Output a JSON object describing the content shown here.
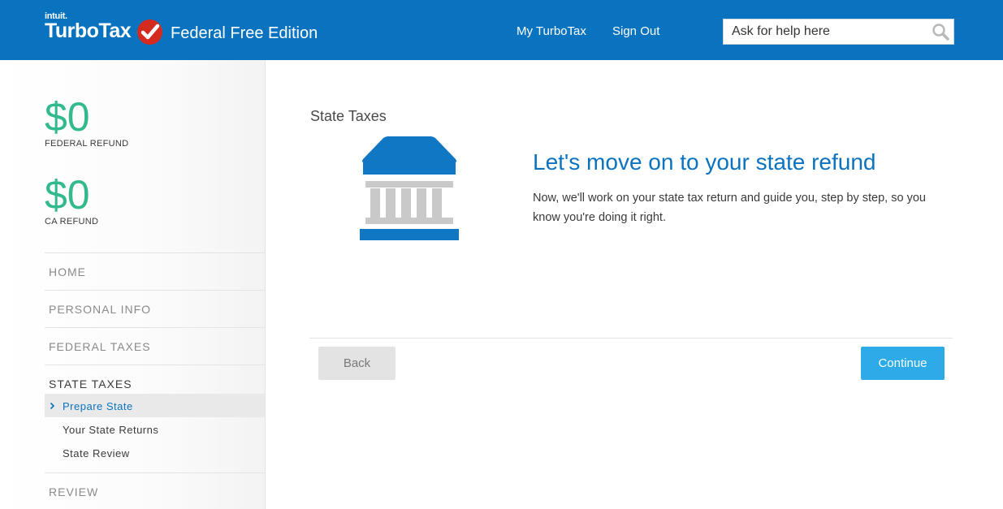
{
  "header": {
    "brand_small": "intuit.",
    "brand": "TurboTax",
    "edition": "Federal Free Edition",
    "nav": [
      {
        "label": "My TurboTax"
      },
      {
        "label": "Sign Out"
      }
    ],
    "search": {
      "placeholder": "Ask for help here",
      "icon": "search-icon"
    },
    "colors": {
      "header_bg": "#0a73bf",
      "check_red": "#d52b1e"
    }
  },
  "sidebar": {
    "refunds": [
      {
        "amount": "$0",
        "label": "FEDERAL REFUND"
      },
      {
        "amount": "$0",
        "label": "CA REFUND"
      }
    ],
    "sections": [
      {
        "label": "HOME"
      },
      {
        "label": "PERSONAL INFO"
      },
      {
        "label": "FEDERAL TAXES"
      },
      {
        "label": "STATE TAXES",
        "active": true
      },
      {
        "label": "REVIEW"
      }
    ],
    "sub_items": [
      {
        "label": "Prepare State",
        "active": true
      },
      {
        "label": "Your State Returns"
      },
      {
        "label": "State Review"
      }
    ],
    "colors": {
      "refund_green": "#32b98e",
      "active_blue": "#0a73bf"
    }
  },
  "main": {
    "title": "State Taxes",
    "illustration": "bank-building-icon",
    "headline": "Let's move on to your state refund",
    "body": "Now, we'll work on your state tax return and guide you, step by step, so you know you're doing it right.",
    "buttons": {
      "back": "Back",
      "continue": "Continue"
    },
    "colors": {
      "continue_bg": "#2cabe8",
      "back_bg": "#e3e3e3"
    }
  }
}
